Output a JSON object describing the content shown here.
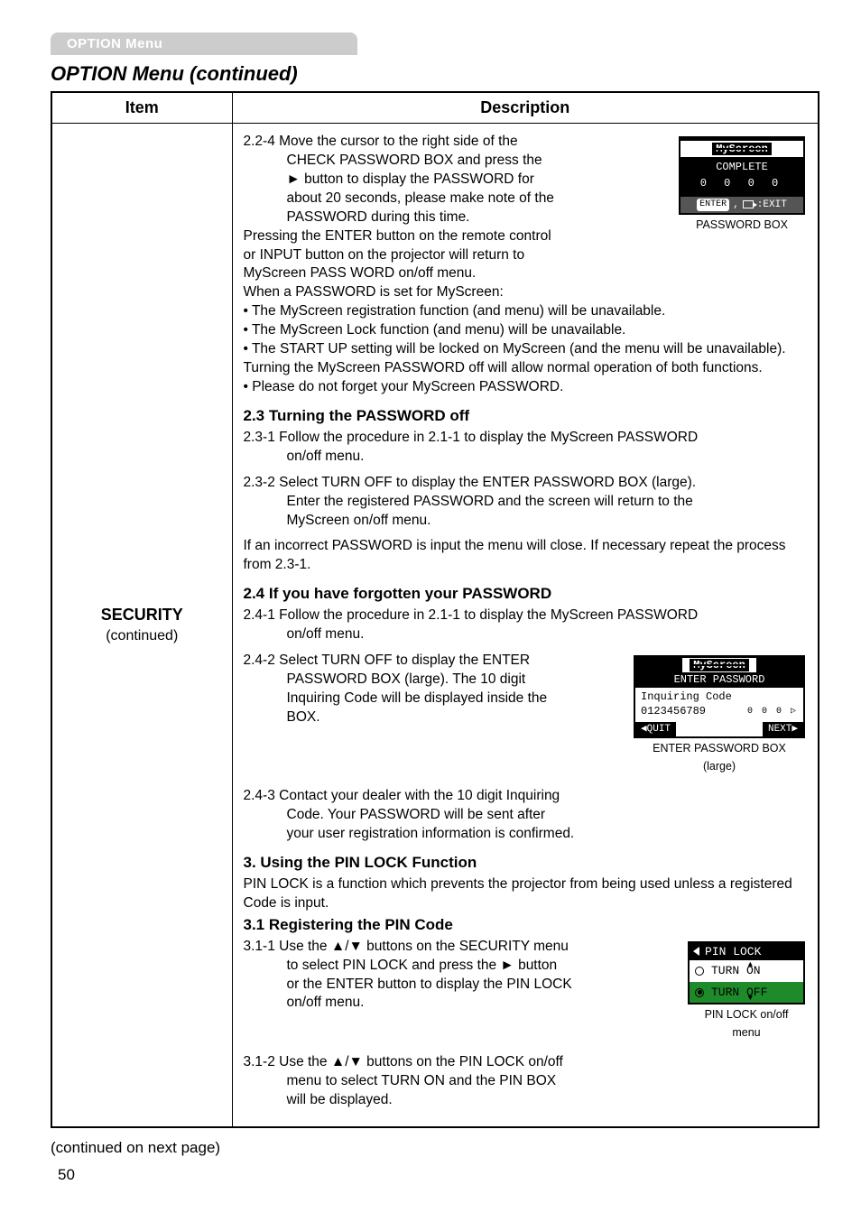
{
  "tab": "OPTION Menu",
  "sectionTitle": "OPTION Menu (continued)",
  "headers": {
    "item": "Item",
    "desc": "Description"
  },
  "item": {
    "name": "SECURITY",
    "sub": "(continued)"
  },
  "contNote": "(continued on next page)",
  "pageNum": "50",
  "b224": {
    "lead": "2.2-4 Move the cursor to the right side of the",
    "l2": "CHECK PASSWORD BOX and press the",
    "l3": "► button to display the PASSWORD for",
    "l4": "about 20 seconds, please make note of the",
    "l5": "PASSWORD during this time.",
    "l6": "Pressing the ENTER button on the remote control",
    "l7": "or INPUT button on the projector will return to",
    "l8": "MyScreen PASS WORD on/off menu.",
    "when": "When a PASSWORD is set for MyScreen:",
    "bul1": "The MyScreen registration function (and menu) will be unavailable.",
    "bul2": "The MyScreen Lock function (and menu) will be unavailable.",
    "bul3": "The START UP setting will be locked on MyScreen (and the menu will be unavailable).",
    "turn": "Turning the MyScreen PASSWORD off will allow normal operation of both functions.",
    "forget": "Please do not forget your MyScreen PASSWORD."
  },
  "s23": {
    "h": "2.3 Turning the PASSWORD off",
    "p1_lead": "2.3-1 Follow the procedure in 2.1-1 to display the MyScreen PASSWORD",
    "p1_cont": "on/off menu.",
    "p2_lead": "2.3-2 Select TURN OFF to display the ENTER PASSWORD BOX (large).",
    "p2_l2": "Enter the registered PASSWORD and the screen will return to the",
    "p2_l3": "MyScreen on/off menu.",
    "p3": "If an incorrect PASSWORD is input the menu will close. If necessary repeat the process from 2.3-1."
  },
  "s24": {
    "h": "2.4 If you have forgotten your PASSWORD",
    "p1_lead": "2.4-1 Follow the procedure in 2.1-1 to display the MyScreen PASSWORD",
    "p1_cont": "on/off menu.",
    "p2_lead": "2.4-2 Select TURN OFF to display the ENTER",
    "p2_l2": "PASSWORD BOX (large). The 10 digit",
    "p2_l3": "Inquiring Code will be displayed inside the",
    "p2_l4": "BOX.",
    "p3_lead": "2.4-3 Contact your dealer with the 10 digit Inquiring",
    "p3_l2": "Code. Your PASSWORD will be sent after",
    "p3_l3": "your user registration information is confirmed."
  },
  "s3": {
    "h": "3. Using the PIN LOCK Function",
    "p1": "PIN LOCK is a function which prevents the projector from being used unless a registered Code is input.",
    "h31": "3.1 Registering the PIN Code",
    "p311_lead": "3.1-1 Use the ▲/▼ buttons on the SECURITY menu",
    "p311_l2": "to select PIN LOCK and press the ► button",
    "p311_l3": "or the ENTER button to display the PIN LOCK",
    "p311_l4": "on/off menu.",
    "p312_lead": "3.1-2 Use the ▲/▼ buttons on the PIN LOCK on/off",
    "p312_l2": "menu to select TURN ON and the PIN BOX",
    "p312_l3": "will be displayed."
  },
  "osd": {
    "pwbox": {
      "title": "MyScreen",
      "status": "COMPLETE",
      "digits": "0 0 0 0",
      "enter": "ENTER",
      "exit": ":EXIT",
      "cap": "PASSWORD BOX"
    },
    "inq": {
      "title": "MyScreen",
      "sub": "ENTER PASSWORD",
      "l1": "Inquiring Code",
      "l2": "0123456789",
      "cursor": "0 0 0 ▷",
      "quit": "◀QUIT",
      "next": "NEXT▶",
      "cap1": "ENTER PASSWORD BOX",
      "cap2": "(large)"
    },
    "pin": {
      "title": "PIN LOCK",
      "on": "TURN ON",
      "off": "TURN OFF",
      "cap1": "PIN LOCK on/off",
      "cap2": "menu"
    }
  }
}
